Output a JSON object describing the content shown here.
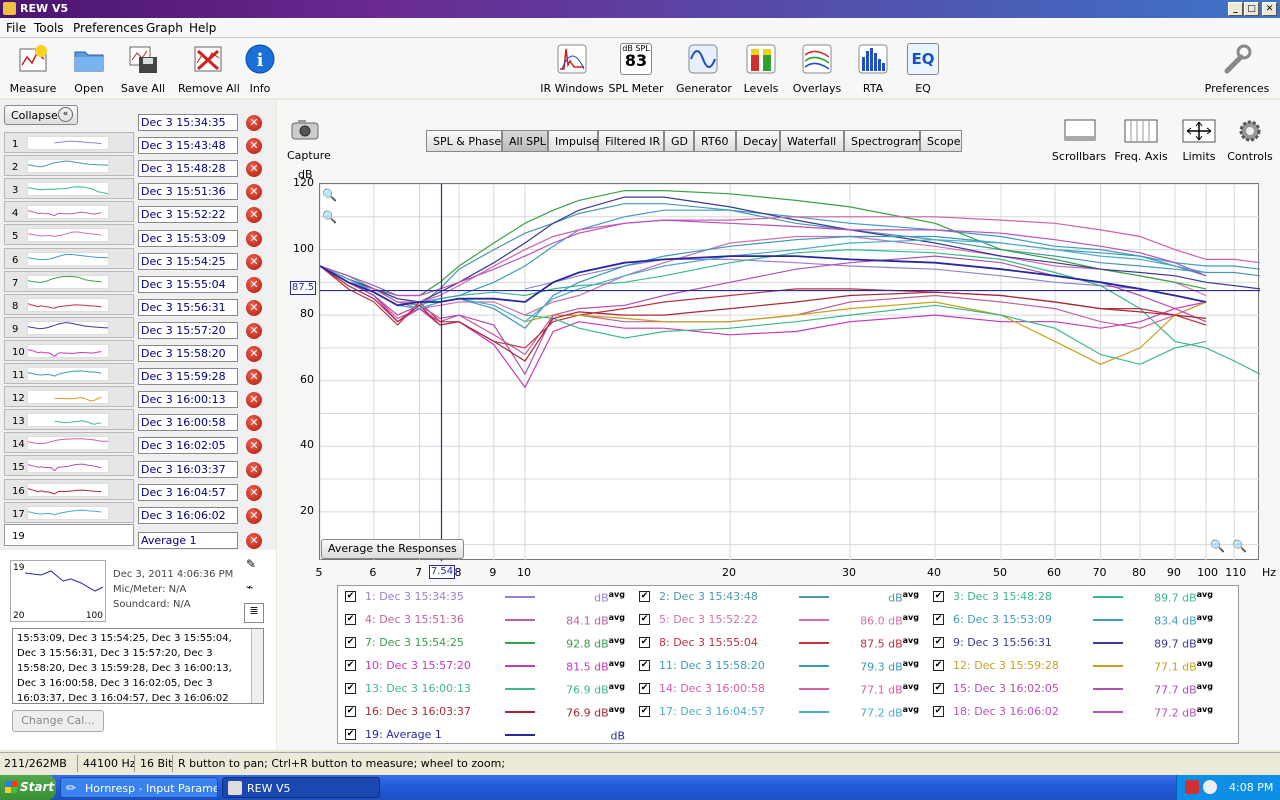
{
  "window": {
    "title": "REW V5"
  },
  "menu": [
    "File",
    "Tools",
    "Preferences",
    "Graph",
    "Help"
  ],
  "toolbar": {
    "left": [
      {
        "label": "Measure",
        "icon": "measure-icon"
      },
      {
        "label": "Open",
        "icon": "folder-icon"
      },
      {
        "label": "Save All",
        "icon": "save-all-icon"
      },
      {
        "label": "Remove All",
        "icon": "remove-all-icon"
      },
      {
        "label": "Info",
        "icon": "info-icon"
      }
    ],
    "center": [
      {
        "label": "IR Windows",
        "icon": "ir-windows-icon"
      },
      {
        "label": "SPL Meter",
        "icon": "spl-meter-icon",
        "top": "dB SPL",
        "value": "83"
      },
      {
        "label": "Generator",
        "icon": "generator-icon"
      },
      {
        "label": "Levels",
        "icon": "levels-icon"
      },
      {
        "label": "Overlays",
        "icon": "overlays-icon"
      },
      {
        "label": "RTA",
        "icon": "rta-icon"
      },
      {
        "label": "EQ",
        "icon": "eq-icon",
        "text": "EQ"
      }
    ],
    "right": {
      "label": "Preferences",
      "icon": "wrench-icon"
    }
  },
  "left_panel": {
    "collapse_label": "Collapse",
    "measurements": [
      {
        "num": "1",
        "name": "Dec 3 15:34:35"
      },
      {
        "num": "2",
        "name": "Dec 3 15:43:48"
      },
      {
        "num": "3",
        "name": "Dec 3 15:48:28"
      },
      {
        "num": "4",
        "name": "Dec 3 15:51:36"
      },
      {
        "num": "5",
        "name": "Dec 3 15:52:22"
      },
      {
        "num": "6",
        "name": "Dec 3 15:53:09"
      },
      {
        "num": "7",
        "name": "Dec 3 15:54:25"
      },
      {
        "num": "8",
        "name": "Dec 3 15:55:04"
      },
      {
        "num": "9",
        "name": "Dec 3 15:56:31"
      },
      {
        "num": "10",
        "name": "Dec 3 15:57:20"
      },
      {
        "num": "11",
        "name": "Dec 3 15:58:20"
      },
      {
        "num": "12",
        "name": "Dec 3 15:59:28"
      },
      {
        "num": "13",
        "name": "Dec 3 16:00:13"
      },
      {
        "num": "14",
        "name": "Dec 3 16:00:58"
      },
      {
        "num": "15",
        "name": "Dec 3 16:02:05"
      },
      {
        "num": "16",
        "name": "Dec 3 16:03:37"
      },
      {
        "num": "17",
        "name": "Dec 3 16:04:57"
      },
      {
        "num": "18",
        "name": "Dec 3 16:06:02"
      }
    ],
    "selected": {
      "num": "19",
      "name": "Average 1",
      "date": "Dec 3, 2011 4:06:36 PM",
      "mic": "Mic/Meter: N/A",
      "soundcard": "Soundcard: N/A",
      "thumb_x_left": "20",
      "thumb_x_right": "100"
    },
    "notes": [
      "15:53:09, Dec 3 15:54:25, Dec 3 15:55:04,",
      "Dec 3 15:56:31, Dec 3 15:57:20, Dec 3",
      "15:58:20, Dec 3 15:59:28, Dec 3 16:00:13,",
      "Dec 3 16:00:58, Dec 3 16:02:05, Dec 3",
      "16:03:37, Dec 3 16:04:57, Dec 3 16:06:02"
    ],
    "change_cal_label": "Change Cal..."
  },
  "capture_label": "Capture",
  "tabs": [
    "SPL & Phase",
    "All SPL",
    "Impulse",
    "Filtered IR",
    "GD",
    "RT60",
    "Decay",
    "Waterfall",
    "Spectrogram",
    "Scope"
  ],
  "selected_tab": "All SPL",
  "right_tools": [
    {
      "label": "Scrollbars",
      "icon": "scrollbars-icon"
    },
    {
      "label": "Freq. Axis",
      "icon": "freq-axis-icon"
    },
    {
      "label": "Limits",
      "icon": "limits-icon"
    },
    {
      "label": "Controls",
      "icon": "gear-icon"
    }
  ],
  "chart_data": {
    "type": "line",
    "ylabel": "dB",
    "xunit": "Hz",
    "xscale": "log",
    "xlim": [
      5,
      120
    ],
    "ylim": [
      5,
      120
    ],
    "yticks": [
      120,
      100,
      80,
      60,
      40,
      20
    ],
    "xticks": [
      "5",
      "6",
      "7",
      "8",
      "9",
      "10",
      "20",
      "30",
      "40",
      "50",
      "60",
      "70",
      "80",
      "90",
      "100",
      "110"
    ],
    "cursor": {
      "x": "7.54",
      "y": "87.5"
    },
    "average_button": "Average the Responses",
    "x": [
      5,
      5.5,
      6,
      6.5,
      7,
      7.5,
      8,
      9,
      10,
      11,
      12,
      14,
      16,
      20,
      25,
      30,
      40,
      50,
      60,
      70,
      80,
      90,
      100,
      110,
      120
    ],
    "series": [
      {
        "name": "1: Dec 3 15:34:35",
        "color": "#9a7fd0",
        "values": [
          null,
          null,
          null,
          null,
          null,
          null,
          null,
          null,
          88,
          90,
          92,
          95,
          97,
          97,
          96,
          95,
          94,
          92,
          90,
          89,
          88,
          86,
          84,
          null,
          null
        ]
      },
      {
        "name": "2: Dec 3 15:43:48",
        "color": "#4a98a8",
        "values": [
          95,
          90,
          88,
          84,
          83,
          88,
          94,
          100,
          105,
          108,
          111,
          114,
          114,
          112,
          108,
          106,
          103,
          100,
          98,
          96,
          95,
          94,
          93,
          93,
          92
        ]
      },
      {
        "name": "3: Dec 3 15:48:28",
        "color": "#3ab88c",
        "values": [
          95,
          92,
          88,
          84,
          83,
          85,
          86,
          87,
          86,
          88,
          89,
          90,
          92,
          96,
          99,
          100,
          99,
          97,
          93,
          89,
          82,
          72,
          70,
          66,
          62
        ]
      },
      {
        "name": "4: Dec 3 15:51:36",
        "color": "#c060a0",
        "values": [
          95,
          90,
          86,
          79,
          82,
          78,
          80,
          74,
          68,
          80,
          80,
          78,
          78,
          78,
          80,
          84,
          86,
          84,
          82,
          78,
          76,
          80,
          84,
          null,
          null
        ]
      },
      {
        "name": "5: Dec 3 15:52:22",
        "color": "#d070b0",
        "values": [
          95,
          90,
          88,
          84,
          82,
          83,
          84,
          84,
          80,
          84,
          86,
          92,
          96,
          102,
          104,
          104,
          101,
          98,
          95,
          94,
          92,
          90,
          86,
          null,
          null
        ]
      },
      {
        "name": "6: Dec 3 15:53:09",
        "color": "#409cc0",
        "values": [
          95,
          91,
          88,
          85,
          84,
          85,
          86,
          90,
          95,
          101,
          106,
          110,
          112,
          112,
          110,
          108,
          106,
          104,
          101,
          100,
          98,
          96,
          95,
          95,
          94
        ]
      },
      {
        "name": "7: Dec 3 15:54:25",
        "color": "#38a048",
        "values": [
          95,
          91,
          88,
          86,
          86,
          90,
          95,
          102,
          108,
          112,
          115,
          118,
          118,
          117,
          115,
          113,
          108,
          100,
          97,
          94,
          92,
          90,
          88,
          null,
          null
        ]
      },
      {
        "name": "8: Dec 3 15:55:04",
        "color": "#c03040",
        "values": [
          95,
          88,
          84,
          77,
          84,
          78,
          78,
          72,
          70,
          78,
          80,
          82,
          84,
          86,
          88,
          88,
          87,
          86,
          84,
          82,
          82,
          80,
          77,
          null,
          null
        ]
      },
      {
        "name": "9: Dec 3 15:56:31",
        "color": "#3a3a98",
        "values": [
          95,
          91,
          88,
          85,
          84,
          87,
          90,
          96,
          102,
          108,
          112,
          116,
          116,
          113,
          109,
          106,
          102,
          98,
          96,
          94,
          93,
          92,
          90,
          89,
          88
        ]
      },
      {
        "name": "10: Dec 3 15:57:20",
        "color": "#c838b8",
        "values": [
          95,
          90,
          86,
          78,
          82,
          77,
          78,
          71,
          58,
          75,
          78,
          76,
          76,
          74,
          75,
          78,
          80,
          78,
          78,
          76,
          78,
          82,
          84,
          null,
          null
        ]
      },
      {
        "name": "11: Dec 3 15:58:20",
        "color": "#3a9ab8",
        "values": [
          95,
          90,
          87,
          83,
          82,
          84,
          85,
          82,
          76,
          86,
          90,
          95,
          98,
          101,
          103,
          104,
          104,
          102,
          100,
          99,
          98,
          95,
          92,
          null,
          null
        ]
      },
      {
        "name": "12: Dec 3 15:59:28",
        "color": "#c8a020",
        "values": [
          null,
          null,
          null,
          null,
          null,
          null,
          null,
          null,
          78,
          80,
          80,
          79,
          78,
          78,
          80,
          82,
          84,
          80,
          72,
          65,
          70,
          80,
          84,
          null,
          null
        ]
      },
      {
        "name": "13: Dec 3 16:00:13",
        "color": "#40b888",
        "values": [
          null,
          null,
          null,
          null,
          null,
          null,
          null,
          null,
          80,
          79,
          76,
          73,
          75,
          76,
          78,
          80,
          83,
          80,
          76,
          68,
          65,
          70,
          72,
          null,
          null
        ]
      },
      {
        "name": "14: Dec 3 16:00:58",
        "color": "#d060a8",
        "values": [
          95,
          90,
          88,
          84,
          84,
          86,
          89,
          95,
          100,
          104,
          106,
          108,
          109,
          109,
          110,
          110,
          110,
          109,
          108,
          106,
          104,
          100,
          97,
          97,
          96
        ]
      },
      {
        "name": "15: Dec 3 16:02:05",
        "color": "#b050b0",
        "values": [
          95,
          90,
          86,
          80,
          83,
          79,
          80,
          77,
          62,
          80,
          82,
          83,
          86,
          90,
          94,
          96,
          98,
          96,
          92,
          90,
          86,
          82,
          78,
          null,
          null
        ]
      },
      {
        "name": "16: Dec 3 16:03:37",
        "color": "#a82838",
        "values": [
          95,
          89,
          85,
          78,
          83,
          77,
          78,
          72,
          66,
          79,
          81,
          80,
          80,
          82,
          84,
          86,
          87,
          86,
          84,
          82,
          81,
          80,
          79,
          null,
          null
        ]
      },
      {
        "name": "17: Dec 3 16:04:57",
        "color": "#4aaccc",
        "values": [
          95,
          91,
          87,
          83,
          82,
          84,
          85,
          83,
          78,
          85,
          88,
          92,
          95,
          98,
          100,
          102,
          103,
          102,
          100,
          98,
          97,
          95,
          93,
          null,
          null
        ]
      },
      {
        "name": "18: Dec 3 16:06:02",
        "color": "#b850c0",
        "values": [
          95,
          92,
          89,
          86,
          86,
          88,
          90,
          94,
          98,
          102,
          105,
          108,
          109,
          108,
          107,
          106,
          106,
          105,
          103,
          101,
          99,
          96,
          92,
          null,
          null
        ]
      },
      {
        "name": "19: Average 1",
        "color": "#2828a0",
        "values": [
          95,
          90,
          87,
          83,
          84,
          84,
          85,
          85,
          84,
          90,
          93,
          96,
          97,
          98,
          98,
          97,
          96,
          94,
          92,
          90,
          88,
          86,
          84,
          null,
          null
        ]
      }
    ]
  },
  "legend_values": [
    "",
    "",
    "89.7",
    "84.1",
    "86.0",
    "83.4",
    "92.8",
    "87.5",
    "89.7",
    "81.5",
    "79.3",
    "77.1",
    "76.9",
    "77.1",
    "77.7",
    "76.9",
    "77.2",
    "77.2",
    ""
  ],
  "legend_unit": "dB",
  "legend_suffix": "avg",
  "status": {
    "memory": "211/262MB",
    "rate": "44100 Hz",
    "bits": "16 Bit",
    "hint": "R button to pan; Ctrl+R button to measure; wheel to zoom;"
  },
  "taskbar": {
    "start": "Start",
    "tasks": [
      "Hornresp - Input Parame...",
      "REW V5"
    ],
    "clock": "4:08 PM"
  }
}
